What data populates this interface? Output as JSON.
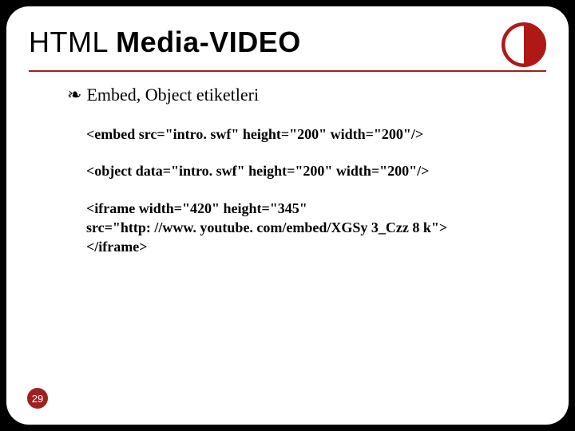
{
  "header": {
    "title_plain": "HTML ",
    "title_bold": "Media-VIDEO"
  },
  "bullet": {
    "glyph": "❧",
    "text": "Embed, Object etiketleri"
  },
  "code": {
    "line1": "<embed src=\"intro. swf\" height=\"200\" width=\"200\"/>",
    "line2": "<object data=\"intro. swf\" height=\"200\" width=\"200\"/>",
    "line3a": "<iframe width=\"420\" height=\"345\"",
    "line3b": "src=\"http: //www. youtube. com/embed/XGSy 3_Czz 8 k\">",
    "line3c": "</iframe>"
  },
  "page_number": "29",
  "colors": {
    "accent": "#a02020"
  }
}
